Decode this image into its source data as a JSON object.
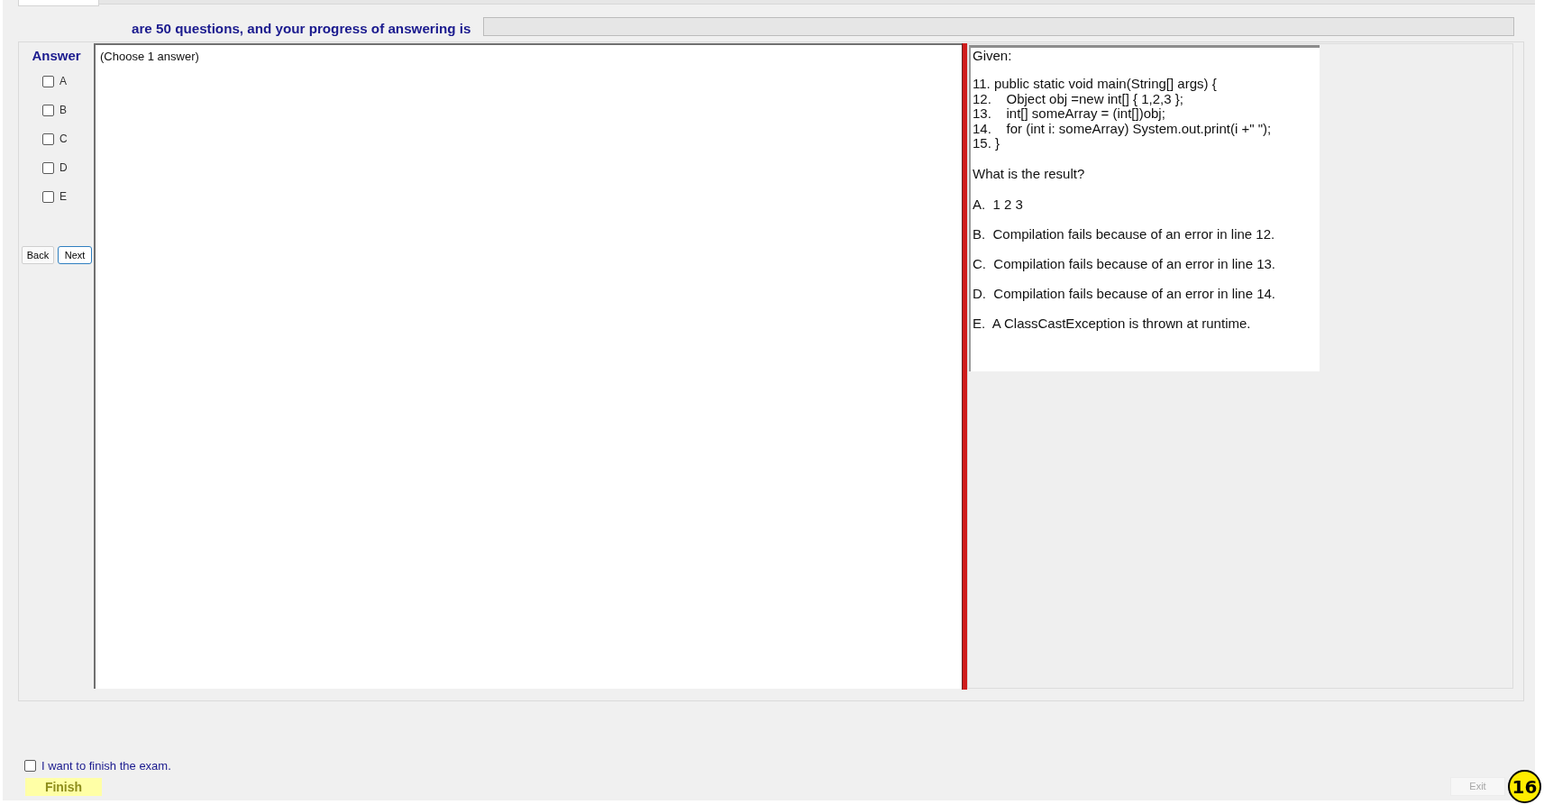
{
  "header": {
    "progress_label": "are 50 questions, and your progress of answering is",
    "progress": {
      "level": 0
    }
  },
  "answer_panel": {
    "title": "Answer",
    "options": [
      {
        "label": "A",
        "checked": false
      },
      {
        "label": "B",
        "checked": false
      },
      {
        "label": "C",
        "checked": false
      },
      {
        "label": "D",
        "checked": false
      },
      {
        "label": "E",
        "checked": false
      }
    ],
    "buttons": [
      {
        "label": "Back",
        "focused": false
      },
      {
        "label": "Next",
        "focused": true
      }
    ]
  },
  "response_area": {
    "instruction": "(Choose 1 answer)"
  },
  "question": {
    "intro": "Given:",
    "code_lines": [
      "11. public static void main(String[] args) {",
      "12.    Object obj =new int[] { 1,2,3 };",
      "13.    int[] someArray = (int[])obj;",
      "14.    for (int i: someArray) System.out.print(i +\" \");",
      "15. }"
    ],
    "prompt": "What is the result?",
    "options": [
      "A.  1 2 3",
      "B.  Compilation fails because of an error in line 12.",
      "C.  Compilation fails because of an error in line 13.",
      "D.  Compilation fails because of an error in line 14.",
      "E.  A ClassCastException is thrown at runtime."
    ]
  },
  "footer": {
    "confirm": {
      "label": "I want to finish the exam.",
      "checked": false
    },
    "finish_button": {
      "label": "Finish"
    },
    "exit_button": {
      "label": "Exit",
      "disabled": true
    }
  },
  "question_badge": "16"
}
